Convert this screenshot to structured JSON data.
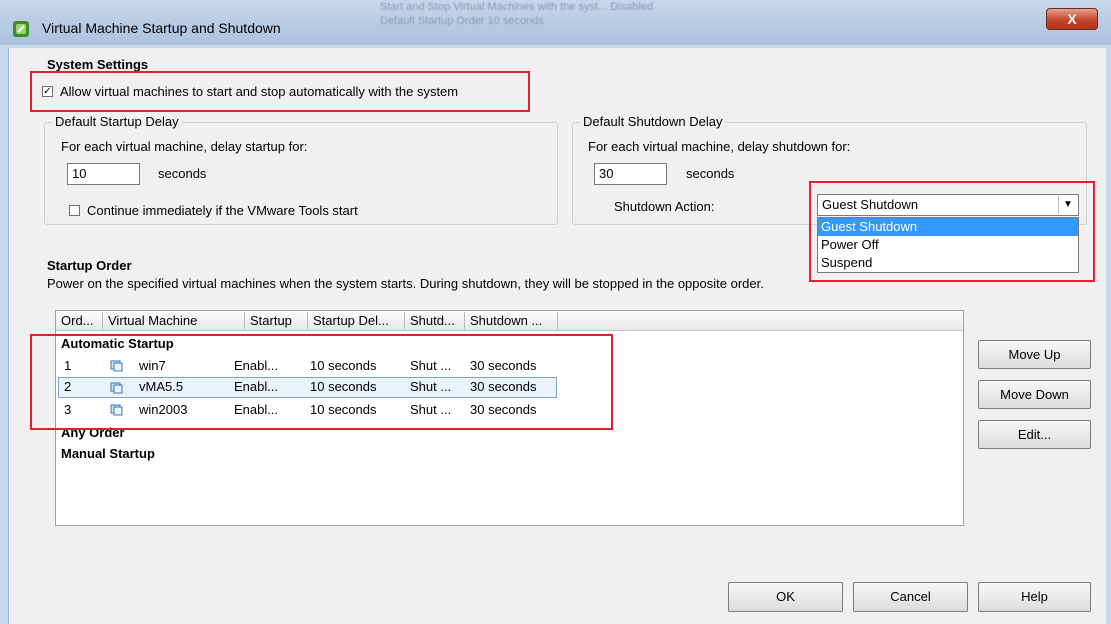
{
  "window": {
    "title": "Virtual Machine Startup and Shutdown",
    "close_glyph": "X",
    "bg_lines": [
      "Start and Stop Virtual Machines with the syst...   Disabled",
      "Default Startup Order                     10 seconds"
    ]
  },
  "system_settings": {
    "heading": "System Settings",
    "auto_start_label": "Allow virtual machines to start and stop automatically with the system",
    "auto_start_checked": true
  },
  "startup_delay": {
    "group_title": "Default Startup Delay",
    "description": "For each virtual machine, delay startup for:",
    "value": "10",
    "unit": "seconds",
    "continue_label": "Continue immediately if the VMware Tools start",
    "continue_checked": false
  },
  "shutdown_delay": {
    "group_title": "Default Shutdown Delay",
    "description": "For each virtual machine, delay shutdown for:",
    "value": "30",
    "unit": "seconds",
    "action_label": "Shutdown Action:",
    "action_selected": "Guest Shutdown",
    "action_options": [
      "Guest Shutdown",
      "Power Off",
      "Suspend"
    ]
  },
  "startup_order": {
    "heading": "Startup Order",
    "description": "Power on the specified virtual machines when the system starts. During shutdown, they will be stopped in the opposite order.",
    "columns": [
      "Ord...",
      "Virtual Machine",
      "Startup",
      "Startup Del...",
      "Shutd...",
      "Shutdown ..."
    ],
    "group_automatic": "Automatic Startup",
    "rows": [
      {
        "order": "1",
        "vm": "win7",
        "startup": "Enabl...",
        "startup_delay": "10 seconds",
        "shutdown": "Shut ...",
        "shutdown_delay": "30 seconds"
      },
      {
        "order": "2",
        "vm": "vMA5.5",
        "startup": "Enabl...",
        "startup_delay": "10 seconds",
        "shutdown": "Shut ...",
        "shutdown_delay": "30 seconds"
      },
      {
        "order": "3",
        "vm": "win2003",
        "startup": "Enabl...",
        "startup_delay": "10 seconds",
        "shutdown": "Shut ...",
        "shutdown_delay": "30 seconds"
      }
    ],
    "group_any": "Any Order",
    "group_manual": "Manual Startup"
  },
  "side_buttons": {
    "move_up": "Move Up",
    "move_down": "Move Down",
    "edit": "Edit..."
  },
  "footer_buttons": {
    "ok": "OK",
    "cancel": "Cancel",
    "help": "Help"
  },
  "colors": {
    "highlight": "#e0202e",
    "selection": "#3399ff"
  }
}
